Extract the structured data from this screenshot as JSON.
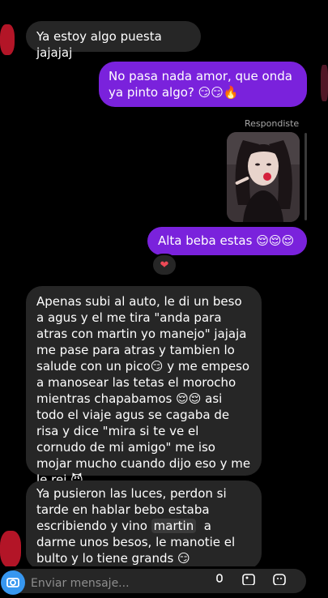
{
  "conversation": {
    "messages": [
      {
        "sender": "them",
        "text": "Ya estoy algo puesta jajajaj"
      },
      {
        "sender": "me",
        "text": "No pasa nada amor, que onda ya pinto algo? 😏😏🔥"
      },
      {
        "sender": "me",
        "text": "Alta beba estas 😌😌😌",
        "reaction": "❤"
      },
      {
        "sender": "them",
        "text": "Apenas subi al auto, le di un beso a agus y el me tira \"anda para atras con martin yo manejo\" jajaja me pase para atras y tambien lo salude con un pico😏 y me empeso a manosear las tetas el morocho mientras chapabamos 😌😌 asi todo el viaje agus se cagaba de risa y dice \"mira si te ve el cornudo de mi amigo\" me iso mojar mucho cuando dijo eso y me le rei 😈"
      },
      {
        "sender": "them",
        "text_before_mention": "Ya pusieron las luces, perdon si tarde en hablar bebo estaba escribiendo y vino ",
        "mention": "martin",
        "text_after_mention": "  a darme unos besos, le manotie el bulto y lo tiene grands 😏\n🔥 despues te cuento que onda"
      }
    ],
    "replied_label": "Respondiste"
  },
  "composer": {
    "placeholder": "Enviar mensaje..."
  },
  "colors": {
    "outgoing_bubble": "#7a22dc",
    "incoming_bubble": "#262626",
    "background": "#000000"
  }
}
